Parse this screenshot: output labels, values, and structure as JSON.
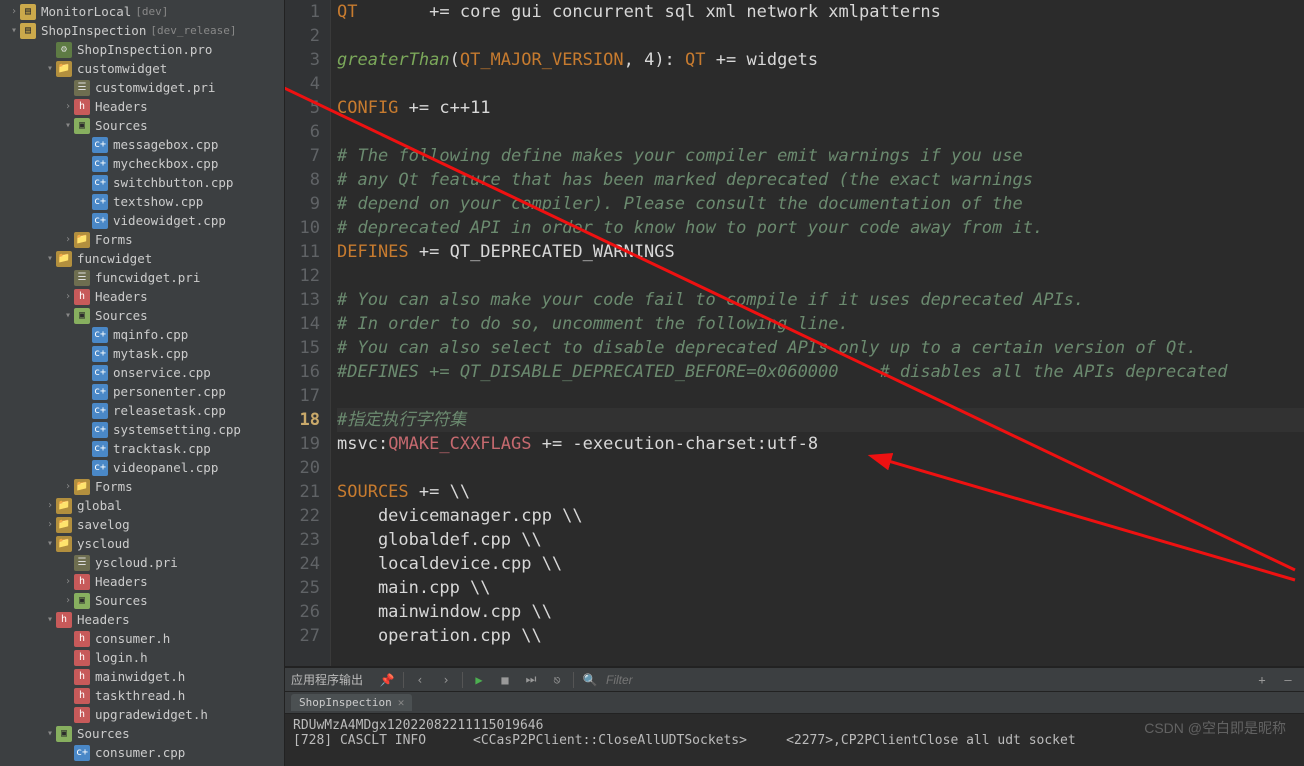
{
  "projects": [
    {
      "name": "MonitorLocal",
      "branch": "[dev]",
      "indent": 0,
      "chev": "›",
      "icon": "prj"
    },
    {
      "name": "ShopInspection",
      "branch": "[dev_release]",
      "indent": 0,
      "chev": "▾",
      "icon": "prj"
    }
  ],
  "tree": [
    {
      "label": "ShopInspection.pro",
      "indent": 1,
      "chev": "",
      "icon": "pro"
    },
    {
      "label": "customwidget",
      "indent": 1,
      "chev": "▾",
      "icon": "folder"
    },
    {
      "label": "customwidget.pri",
      "indent": 2,
      "chev": "",
      "icon": "pri"
    },
    {
      "label": "Headers",
      "indent": 2,
      "chev": "›",
      "icon": "h"
    },
    {
      "label": "Sources",
      "indent": 2,
      "chev": "▾",
      "icon": "folder-src"
    },
    {
      "label": "messagebox.cpp",
      "indent": 3,
      "chev": "",
      "icon": "cpp"
    },
    {
      "label": "mycheckbox.cpp",
      "indent": 3,
      "chev": "",
      "icon": "cpp"
    },
    {
      "label": "switchbutton.cpp",
      "indent": 3,
      "chev": "",
      "icon": "cpp"
    },
    {
      "label": "textshow.cpp",
      "indent": 3,
      "chev": "",
      "icon": "cpp"
    },
    {
      "label": "videowidget.cpp",
      "indent": 3,
      "chev": "",
      "icon": "cpp"
    },
    {
      "label": "Forms",
      "indent": 2,
      "chev": "›",
      "icon": "folder"
    },
    {
      "label": "funcwidget",
      "indent": 1,
      "chev": "▾",
      "icon": "folder"
    },
    {
      "label": "funcwidget.pri",
      "indent": 2,
      "chev": "",
      "icon": "pri"
    },
    {
      "label": "Headers",
      "indent": 2,
      "chev": "›",
      "icon": "h"
    },
    {
      "label": "Sources",
      "indent": 2,
      "chev": "▾",
      "icon": "folder-src"
    },
    {
      "label": "mqinfo.cpp",
      "indent": 3,
      "chev": "",
      "icon": "cpp"
    },
    {
      "label": "mytask.cpp",
      "indent": 3,
      "chev": "",
      "icon": "cpp"
    },
    {
      "label": "onservice.cpp",
      "indent": 3,
      "chev": "",
      "icon": "cpp"
    },
    {
      "label": "personenter.cpp",
      "indent": 3,
      "chev": "",
      "icon": "cpp"
    },
    {
      "label": "releasetask.cpp",
      "indent": 3,
      "chev": "",
      "icon": "cpp"
    },
    {
      "label": "systemsetting.cpp",
      "indent": 3,
      "chev": "",
      "icon": "cpp"
    },
    {
      "label": "tracktask.cpp",
      "indent": 3,
      "chev": "",
      "icon": "cpp"
    },
    {
      "label": "videopanel.cpp",
      "indent": 3,
      "chev": "",
      "icon": "cpp"
    },
    {
      "label": "Forms",
      "indent": 2,
      "chev": "›",
      "icon": "folder"
    },
    {
      "label": "global",
      "indent": 1,
      "chev": "›",
      "icon": "folder"
    },
    {
      "label": "savelog",
      "indent": 1,
      "chev": "›",
      "icon": "folder"
    },
    {
      "label": "yscloud",
      "indent": 1,
      "chev": "▾",
      "icon": "folder"
    },
    {
      "label": "yscloud.pri",
      "indent": 2,
      "chev": "",
      "icon": "pri"
    },
    {
      "label": "Headers",
      "indent": 2,
      "chev": "›",
      "icon": "h"
    },
    {
      "label": "Sources",
      "indent": 2,
      "chev": "›",
      "icon": "folder-src"
    },
    {
      "label": "Headers",
      "indent": 1,
      "chev": "▾",
      "icon": "h"
    },
    {
      "label": "consumer.h",
      "indent": 2,
      "chev": "",
      "icon": "h"
    },
    {
      "label": "login.h",
      "indent": 2,
      "chev": "",
      "icon": "h"
    },
    {
      "label": "mainwidget.h",
      "indent": 2,
      "chev": "",
      "icon": "h"
    },
    {
      "label": "taskthread.h",
      "indent": 2,
      "chev": "",
      "icon": "h"
    },
    {
      "label": "upgradewidget.h",
      "indent": 2,
      "chev": "",
      "icon": "h"
    },
    {
      "label": "Sources",
      "indent": 1,
      "chev": "▾",
      "icon": "folder-src"
    },
    {
      "label": "consumer.cpp",
      "indent": 2,
      "chev": "",
      "icon": "cpp"
    }
  ],
  "code": {
    "current_line": 18,
    "lines": [
      {
        "n": 1,
        "html": "<span class='tok-kw'>QT</span>       += core gui concurrent sql xml network xmlpatterns"
      },
      {
        "n": 2,
        "html": ""
      },
      {
        "n": 3,
        "html": "<span class='tok-func'>greaterThan</span>(<span class='tok-kw'>QT_MAJOR_VERSION</span>, 4): <span class='tok-kw'>QT</span> += widgets"
      },
      {
        "n": 4,
        "html": ""
      },
      {
        "n": 5,
        "html": "<span class='tok-kw'>CONFIG</span> += c++11"
      },
      {
        "n": 6,
        "html": ""
      },
      {
        "n": 7,
        "html": "<span class='tok-cmt'># The following define makes your compiler emit warnings if you use</span>"
      },
      {
        "n": 8,
        "html": "<span class='tok-cmt'># any Qt feature that has been marked deprecated (the exact warnings</span>"
      },
      {
        "n": 9,
        "html": "<span class='tok-cmt'># depend on your compiler). Please consult the documentation of the</span>"
      },
      {
        "n": 10,
        "html": "<span class='tok-cmt'># deprecated API in order to know how to port your code away from it.</span>"
      },
      {
        "n": 11,
        "html": "<span class='tok-kw'>DEFINES</span> += QT_DEPRECATED_WARNINGS"
      },
      {
        "n": 12,
        "html": ""
      },
      {
        "n": 13,
        "html": "<span class='tok-cmt'># You can also make your code fail to compile if it uses deprecated APIs.</span>"
      },
      {
        "n": 14,
        "html": "<span class='tok-cmt'># In order to do so, uncomment the following line.</span>"
      },
      {
        "n": 15,
        "html": "<span class='tok-cmt'># You can also select to disable deprecated APIs only up to a certain version of Qt.</span>"
      },
      {
        "n": 16,
        "html": "<span class='tok-cmt'>#DEFINES += QT_DISABLE_DEPRECATED_BEFORE=0x060000    # disables all the APIs deprecated </span>"
      },
      {
        "n": 17,
        "html": ""
      },
      {
        "n": 18,
        "html": "<span class='tok-cmt'>#指定执行字符集</span>"
      },
      {
        "n": 19,
        "html": "msvc:<span class='tok-var'>QMAKE_CXXFLAGS</span> += -execution-charset:utf-8"
      },
      {
        "n": 20,
        "html": ""
      },
      {
        "n": 21,
        "html": "<span class='tok-kw'>SOURCES</span> += \\\\"
      },
      {
        "n": 22,
        "html": "    devicemanager.cpp \\\\"
      },
      {
        "n": 23,
        "html": "    globaldef.cpp \\\\"
      },
      {
        "n": 24,
        "html": "    localdevice.cpp \\\\"
      },
      {
        "n": 25,
        "html": "    main.cpp \\\\"
      },
      {
        "n": 26,
        "html": "    mainwindow.cpp \\\\"
      },
      {
        "n": 27,
        "html": "    operation.cpp \\\\"
      }
    ]
  },
  "output": {
    "title": "应用程序输出",
    "filter_placeholder": "Filter",
    "tab": "ShopInspection",
    "lines": [
      "RDUwMzA4MDgx12022082211115019646",
      "[728] CASCLT INFO      <CCasP2PClient::CloseAllUDTSockets>     <2277>,CP2PClientClose all udt socket"
    ]
  },
  "watermark": "CSDN @空白即是昵称"
}
